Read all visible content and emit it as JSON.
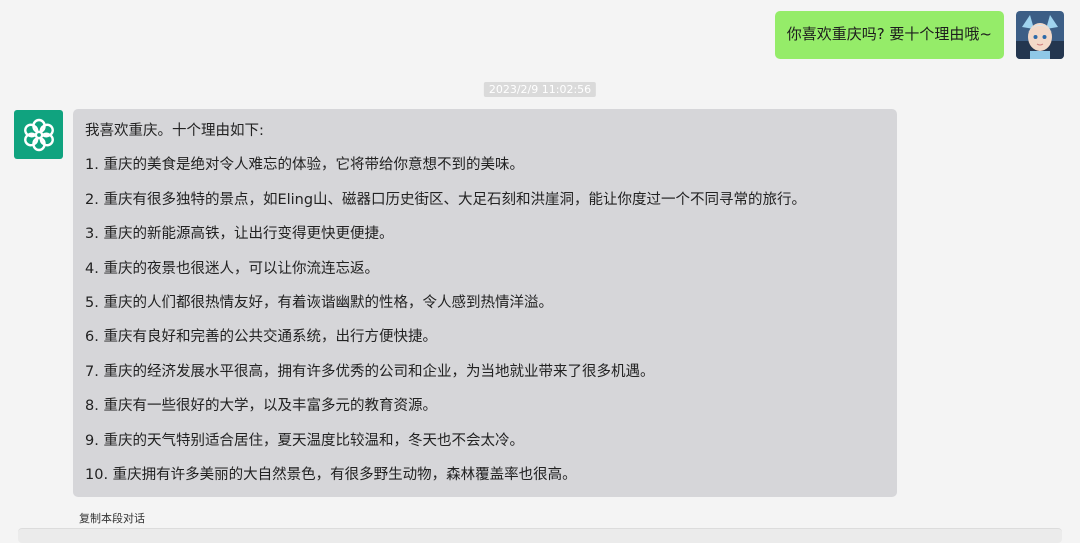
{
  "user_message": "你喜欢重庆吗? 要十个理由哦~",
  "timestamp": "2023/2/9 11:02:56",
  "bot_intro": "我喜欢重庆。十个理由如下:",
  "reasons": [
    "1. 重庆的美食是绝对令人难忘的体验，它将带给你意想不到的美味。",
    "2. 重庆有很多独特的景点，如Eling山、磁器口历史街区、大足石刻和洪崖洞，能让你度过一个不同寻常的旅行。",
    "3. 重庆的新能源高铁，让出行变得更快更便捷。",
    "4. 重庆的夜景也很迷人，可以让你流连忘返。",
    "5. 重庆的人们都很热情友好，有着诙谐幽默的性格，令人感到热情洋溢。",
    "6. 重庆有良好和完善的公共交通系统，出行方便快捷。",
    "7. 重庆的经济发展水平很高，拥有许多优秀的公司和企业，为当地就业带来了很多机遇。",
    "8. 重庆有一些很好的大学，以及丰富多元的教育资源。",
    "9. 重庆的天气特别适合居住，夏天温度比较温和，冬天也不会太冷。",
    "10. 重庆拥有许多美丽的大自然景色，有很多野生动物，森林覆盖率也很高。"
  ],
  "copy_label": "复制本段对话",
  "colors": {
    "user_bubble": "#95ec69",
    "bot_bubble": "#d6d6d9",
    "bot_avatar": "#10a37f"
  },
  "icons": {
    "bot": "openai-logo-icon",
    "user": "user-avatar"
  }
}
